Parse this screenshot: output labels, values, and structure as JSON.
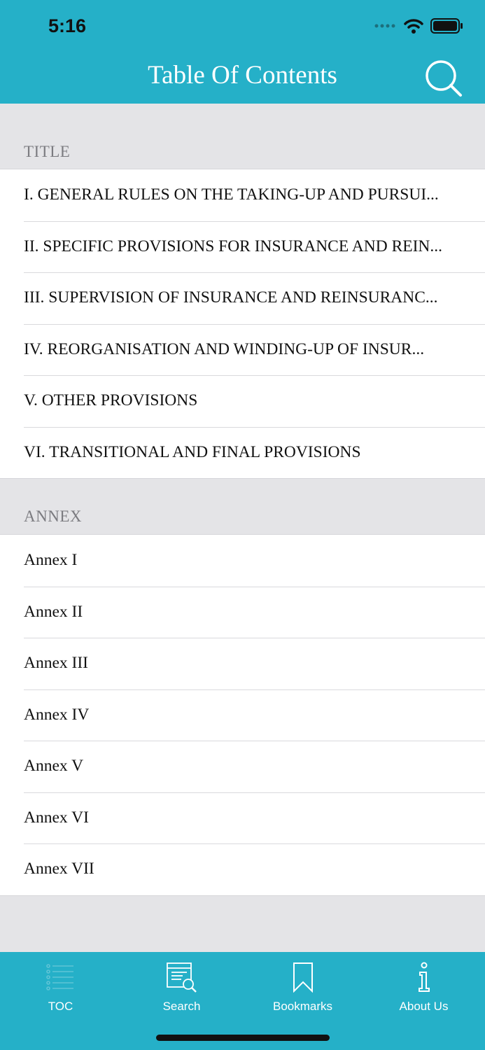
{
  "status_bar": {
    "time": "5:16"
  },
  "nav": {
    "title": "Table Of Contents"
  },
  "sections": [
    {
      "label": "TITLE",
      "items": [
        "I. GENERAL RULES ON THE TAKING-UP AND PURSUI...",
        "II. SPECIFIC PROVISIONS FOR INSURANCE AND REIN...",
        "III.  SUPERVISION OF INSURANCE AND REINSURANC...",
        "IV. REORGANISATION  AND  WINDING-UP OF INSUR...",
        "V. OTHER PROVISIONS",
        "VI. TRANSITIONAL AND FINAL PROVISIONS"
      ]
    },
    {
      "label": "ANNEX",
      "items": [
        "Annex I",
        "Annex II",
        "Annex III",
        "Annex IV",
        "Annex V",
        "Annex VI",
        "Annex VII"
      ]
    }
  ],
  "tabbar": {
    "tabs": [
      {
        "label": "TOC",
        "icon": "list-icon"
      },
      {
        "label": "Search",
        "icon": "document-search-icon"
      },
      {
        "label": "Bookmarks",
        "icon": "bookmark-icon"
      },
      {
        "label": "About Us",
        "icon": "info-icon"
      }
    ]
  },
  "colors": {
    "accent": "#25b0c8",
    "background": "#e4e4e7"
  }
}
